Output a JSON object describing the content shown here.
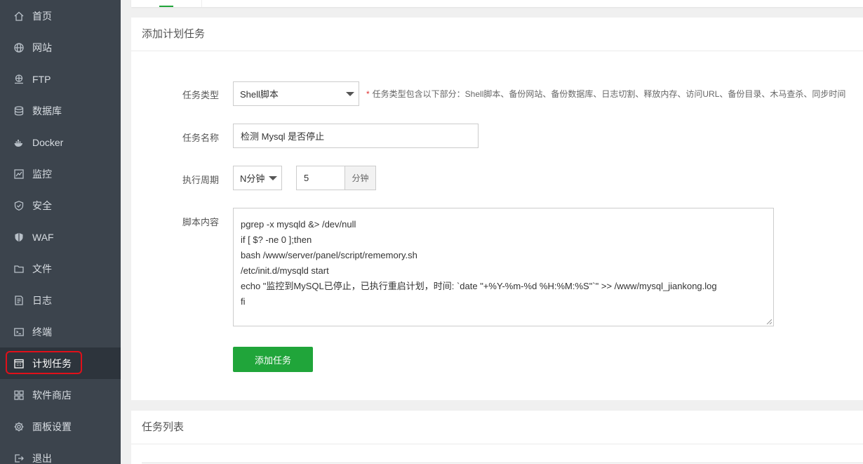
{
  "sidebar": {
    "items": [
      {
        "label": "首页",
        "icon": "home-icon"
      },
      {
        "label": "网站",
        "icon": "globe-icon"
      },
      {
        "label": "FTP",
        "icon": "ftp-icon"
      },
      {
        "label": "数据库",
        "icon": "database-icon"
      },
      {
        "label": "Docker",
        "icon": "docker-icon"
      },
      {
        "label": "监控",
        "icon": "monitor-icon"
      },
      {
        "label": "安全",
        "icon": "shield-icon"
      },
      {
        "label": "WAF",
        "icon": "waf-shield-icon"
      },
      {
        "label": "文件",
        "icon": "folder-icon"
      },
      {
        "label": "日志",
        "icon": "log-icon"
      },
      {
        "label": "终端",
        "icon": "terminal-icon"
      },
      {
        "label": "计划任务",
        "icon": "calendar-icon"
      },
      {
        "label": "软件商店",
        "icon": "apps-grid-icon"
      },
      {
        "label": "面板设置",
        "icon": "gear-icon"
      },
      {
        "label": "退出",
        "icon": "logout-icon"
      }
    ],
    "active_label": "计划任务"
  },
  "add_task": {
    "title": "添加计划任务",
    "type_label": "任务类型",
    "type_value": "Shell脚本",
    "type_hint": "任务类型包含以下部分：Shell脚本、备份网站、备份数据库、日志切割、释放内存、访问URL、备份目录、木马查杀、同步时间",
    "name_label": "任务名称",
    "name_value": "检测 Mysql 是否停止",
    "period_label": "执行周期",
    "period_value": "N分钟",
    "minutes_value": "5",
    "minutes_unit": "分钟",
    "script_label": "脚本内容",
    "script_lines": [
      "pgrep -x mysqld &> /dev/null",
      "if [ $? -ne 0 ];then",
      "bash /www/server/panel/script/rememory.sh",
      "/etc/init.d/mysqld start",
      "echo \"监控到MySQL已停止，已执行重启计划，时间: `date \"+%Y-%m-%d %H:%M:%S\"`\" >> /www/mysql_jiankong.log",
      "fi"
    ],
    "submit_label": "添加任务"
  },
  "task_list": {
    "title": "任务列表"
  },
  "colors": {
    "sidebar_bg": "#3c444d",
    "sidebar_active_bg": "#2d343c",
    "accent_green": "#20a53a",
    "highlight_red": "#e0101a"
  }
}
